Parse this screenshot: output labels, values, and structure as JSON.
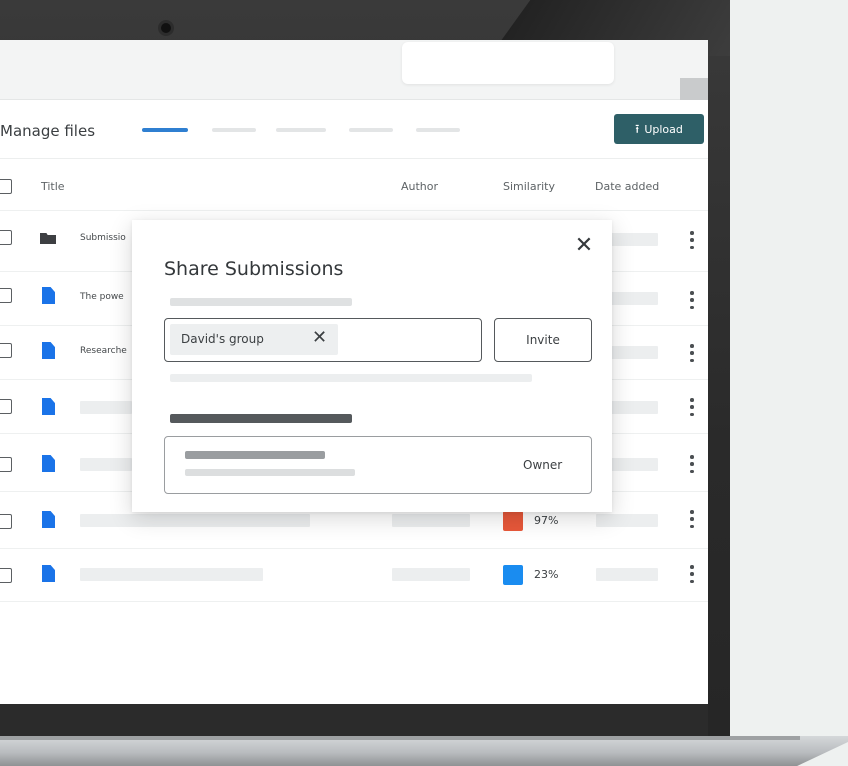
{
  "page": {
    "title": "Manage files",
    "upload_label": "Upload",
    "upload_icon": "upload-icon"
  },
  "columns": {
    "title": "Title",
    "author": "Author",
    "similarity": "Similarity",
    "date_added": "Date added"
  },
  "rows": [
    {
      "type": "folder",
      "title": "Submissio",
      "similarity": null
    },
    {
      "type": "file",
      "title": "The powe",
      "similarity": null
    },
    {
      "type": "file",
      "title": "Researche",
      "similarity": null
    },
    {
      "type": "file",
      "title": "",
      "similarity": null
    },
    {
      "type": "file",
      "title": "",
      "similarity": null
    },
    {
      "type": "file",
      "title": "",
      "similarity": "97%",
      "similarity_color": "#e8583a"
    },
    {
      "type": "file",
      "title": "",
      "similarity": "23%",
      "similarity_color": "#1a8cf0"
    }
  ],
  "dialog": {
    "title": "Share Submissions",
    "chip_label": "David's group",
    "invite_label": "Invite",
    "owner_label": "Owner",
    "close_icon": "close-icon"
  },
  "colors": {
    "accent": "#2f7fd1",
    "upload_button": "#2e5f67",
    "file_icon": "#1a73e8",
    "high_similarity": "#e8583a",
    "low_similarity": "#1a8cf0"
  }
}
